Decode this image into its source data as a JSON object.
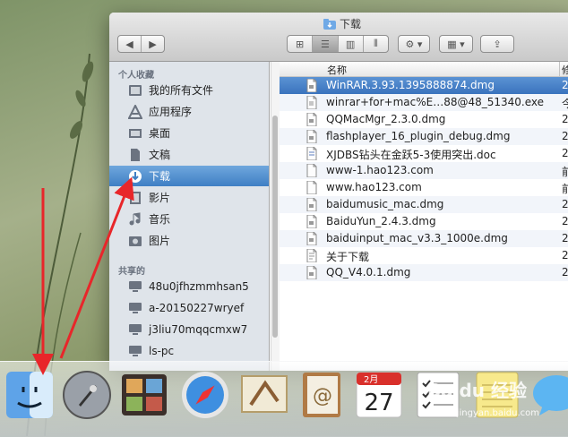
{
  "window": {
    "title": "下载"
  },
  "sidebar": {
    "favorites_heading": "个人收藏",
    "favorites": [
      {
        "label": "我的所有文件",
        "icon": "all-files-icon"
      },
      {
        "label": "应用程序",
        "icon": "applications-icon"
      },
      {
        "label": "桌面",
        "icon": "desktop-icon"
      },
      {
        "label": "文稿",
        "icon": "documents-icon"
      },
      {
        "label": "下载",
        "icon": "downloads-icon",
        "selected": true
      },
      {
        "label": "影片",
        "icon": "movies-icon"
      },
      {
        "label": "音乐",
        "icon": "music-icon"
      },
      {
        "label": "图片",
        "icon": "pictures-icon"
      }
    ],
    "shared_heading": "共享的",
    "shared": [
      {
        "label": "48u0jfhzmmhsan5",
        "icon": "computer-icon"
      },
      {
        "label": "a-20150227wryef",
        "icon": "computer-icon"
      },
      {
        "label": "j3liu70mqqcmxw7",
        "icon": "computer-icon"
      },
      {
        "label": "ls-pc",
        "icon": "computer-icon"
      }
    ]
  },
  "list": {
    "columns": {
      "name": "名称",
      "date": "修"
    },
    "rows": [
      {
        "name": "WinRAR.3.93.1395888874.dmg",
        "date": "2",
        "icon": "dmg-file-icon",
        "selected": true
      },
      {
        "name": "winrar+for+mac%E…88@48_51340.exe",
        "date": "今",
        "icon": "exe-file-icon"
      },
      {
        "name": "QQMacMgr_2.3.0.dmg",
        "date": "2",
        "icon": "dmg-file-icon"
      },
      {
        "name": "flashplayer_16_plugin_debug.dmg",
        "date": "2",
        "icon": "dmg-file-icon"
      },
      {
        "name": "XJDBS钻头在金跃5-3使用突出.doc",
        "date": "2",
        "icon": "doc-file-icon"
      },
      {
        "name": "www-1.hao123.com",
        "date": "前",
        "icon": "file-icon"
      },
      {
        "name": "www.hao123.com",
        "date": "前",
        "icon": "file-icon"
      },
      {
        "name": "baidumusic_mac.dmg",
        "date": "2",
        "icon": "dmg-file-icon"
      },
      {
        "name": "BaiduYun_2.4.3.dmg",
        "date": "2",
        "icon": "dmg-file-icon"
      },
      {
        "name": "baiduinput_mac_v3.3_1000e.dmg",
        "date": "2",
        "icon": "dmg-file-icon"
      },
      {
        "name": "关于下载",
        "date": "2",
        "icon": "text-file-icon"
      },
      {
        "name": "QQ_V4.0.1.dmg",
        "date": "2",
        "icon": "dmg-file-icon"
      }
    ]
  },
  "dock": {
    "items": [
      "finder-icon",
      "launchpad-icon",
      "photo-booth-icon",
      "safari-icon",
      "mail-icon",
      "contacts-icon",
      "calendar-icon",
      "reminders-icon",
      "notes-icon",
      "messages-icon"
    ],
    "calendar": {
      "month": "2月",
      "day": "27"
    }
  },
  "watermark": {
    "text": "Baidu 经验",
    "sub": "jingyan.baidu.com"
  }
}
